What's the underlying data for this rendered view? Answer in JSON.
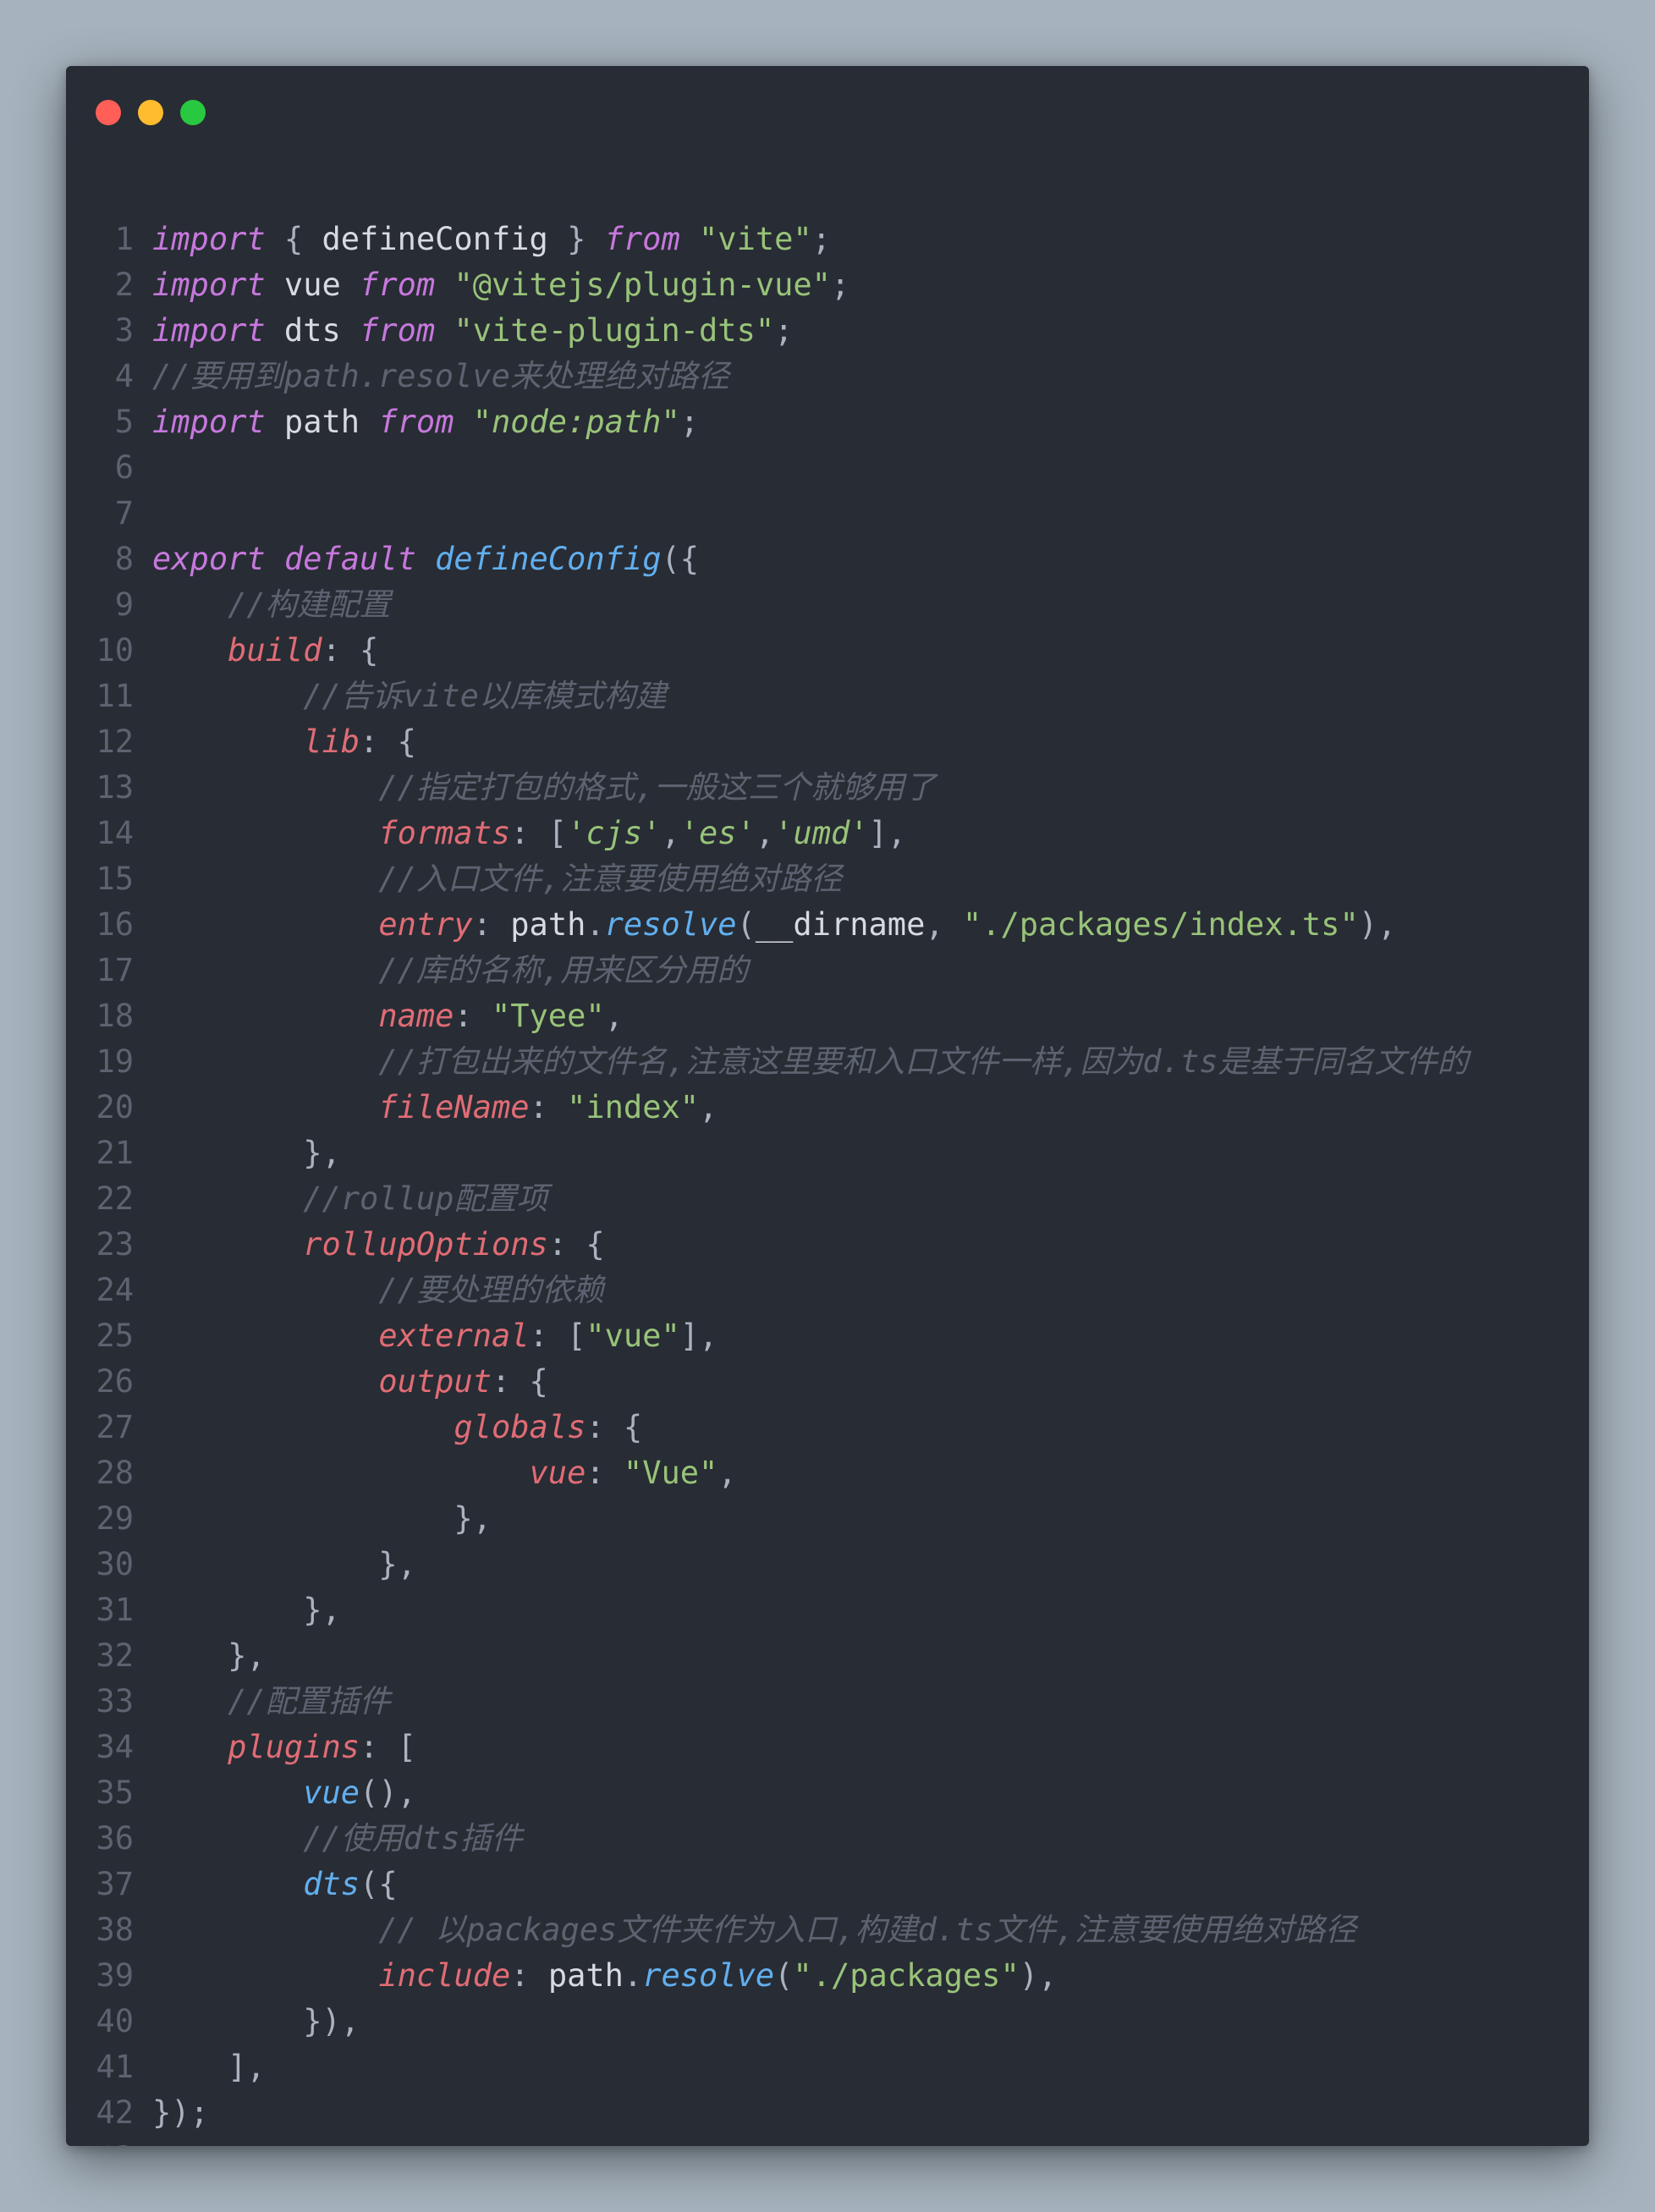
{
  "window": {
    "controls": [
      {
        "name": "close",
        "color": "#ff5f57"
      },
      {
        "name": "minimize",
        "color": "#febc2e"
      },
      {
        "name": "maximize",
        "color": "#28c840"
      }
    ]
  },
  "code": {
    "lines": [
      [
        {
          "t": "import",
          "c": "kw"
        },
        {
          "t": " { ",
          "c": "punc"
        },
        {
          "t": "defineConfig",
          "c": "plain"
        },
        {
          "t": " } ",
          "c": "punc"
        },
        {
          "t": "from",
          "c": "kw"
        },
        {
          "t": " ",
          "c": "punc"
        },
        {
          "t": "\"vite\"",
          "c": "str"
        },
        {
          "t": ";",
          "c": "punc"
        }
      ],
      [
        {
          "t": "import",
          "c": "kw"
        },
        {
          "t": " vue ",
          "c": "plain"
        },
        {
          "t": "from",
          "c": "kw"
        },
        {
          "t": " ",
          "c": "punc"
        },
        {
          "t": "\"@vitejs/plugin-vue\"",
          "c": "str"
        },
        {
          "t": ";",
          "c": "punc"
        }
      ],
      [
        {
          "t": "import",
          "c": "kw"
        },
        {
          "t": " dts ",
          "c": "plain"
        },
        {
          "t": "from",
          "c": "kw"
        },
        {
          "t": " ",
          "c": "punc"
        },
        {
          "t": "\"vite-plugin-dts\"",
          "c": "str"
        },
        {
          "t": ";",
          "c": "punc"
        }
      ],
      [
        {
          "t": "//要用到path.resolve来处理绝对路径",
          "c": "cm"
        }
      ],
      [
        {
          "t": "import",
          "c": "kw"
        },
        {
          "t": " path ",
          "c": "plain"
        },
        {
          "t": "from",
          "c": "kw"
        },
        {
          "t": " ",
          "c": "punc"
        },
        {
          "t": "\"node:path\"",
          "c": "str-i"
        },
        {
          "t": ";",
          "c": "punc"
        }
      ],
      [],
      [],
      [
        {
          "t": "export",
          "c": "kw"
        },
        {
          "t": " ",
          "c": "punc"
        },
        {
          "t": "default",
          "c": "kw"
        },
        {
          "t": " ",
          "c": "punc"
        },
        {
          "t": "defineConfig",
          "c": "fn"
        },
        {
          "t": "({",
          "c": "punc"
        }
      ],
      [
        {
          "t": "    ",
          "c": "punc"
        },
        {
          "t": "//构建配置",
          "c": "cm"
        }
      ],
      [
        {
          "t": "    ",
          "c": "punc"
        },
        {
          "t": "build",
          "c": "prop"
        },
        {
          "t": ": {",
          "c": "punc"
        }
      ],
      [
        {
          "t": "        ",
          "c": "punc"
        },
        {
          "t": "//告诉vite以库模式构建",
          "c": "cm"
        }
      ],
      [
        {
          "t": "        ",
          "c": "punc"
        },
        {
          "t": "lib",
          "c": "prop"
        },
        {
          "t": ": {",
          "c": "punc"
        }
      ],
      [
        {
          "t": "            ",
          "c": "punc"
        },
        {
          "t": "//指定打包的格式,一般这三个就够用了",
          "c": "cm"
        }
      ],
      [
        {
          "t": "            ",
          "c": "punc"
        },
        {
          "t": "formats",
          "c": "prop"
        },
        {
          "t": ": [",
          "c": "punc"
        },
        {
          "t": "'cjs'",
          "c": "str-i"
        },
        {
          "t": ",",
          "c": "punc"
        },
        {
          "t": "'es'",
          "c": "str-i"
        },
        {
          "t": ",",
          "c": "punc"
        },
        {
          "t": "'umd'",
          "c": "str-i"
        },
        {
          "t": "],",
          "c": "punc"
        }
      ],
      [
        {
          "t": "            ",
          "c": "punc"
        },
        {
          "t": "//入口文件,注意要使用绝对路径",
          "c": "cm"
        }
      ],
      [
        {
          "t": "            ",
          "c": "punc"
        },
        {
          "t": "entry",
          "c": "prop"
        },
        {
          "t": ": ",
          "c": "punc"
        },
        {
          "t": "path",
          "c": "plain"
        },
        {
          "t": ".",
          "c": "punc"
        },
        {
          "t": "resolve",
          "c": "fn"
        },
        {
          "t": "(",
          "c": "punc"
        },
        {
          "t": "__dirname",
          "c": "plain"
        },
        {
          "t": ", ",
          "c": "punc"
        },
        {
          "t": "\"./packages/index.ts\"",
          "c": "str"
        },
        {
          "t": "),",
          "c": "punc"
        }
      ],
      [
        {
          "t": "            ",
          "c": "punc"
        },
        {
          "t": "//库的名称,用来区分用的",
          "c": "cm"
        }
      ],
      [
        {
          "t": "            ",
          "c": "punc"
        },
        {
          "t": "name",
          "c": "prop"
        },
        {
          "t": ": ",
          "c": "punc"
        },
        {
          "t": "\"Tyee\"",
          "c": "str"
        },
        {
          "t": ",",
          "c": "punc"
        }
      ],
      [
        {
          "t": "            ",
          "c": "punc"
        },
        {
          "t": "//打包出来的文件名,注意这里要和入口文件一样,因为d.ts是基于同名文件的",
          "c": "cm"
        }
      ],
      [
        {
          "t": "            ",
          "c": "punc"
        },
        {
          "t": "fileName",
          "c": "prop"
        },
        {
          "t": ": ",
          "c": "punc"
        },
        {
          "t": "\"index\"",
          "c": "str"
        },
        {
          "t": ",",
          "c": "punc"
        }
      ],
      [
        {
          "t": "        },",
          "c": "punc"
        }
      ],
      [
        {
          "t": "        ",
          "c": "punc"
        },
        {
          "t": "//rollup配置项",
          "c": "cm"
        }
      ],
      [
        {
          "t": "        ",
          "c": "punc"
        },
        {
          "t": "rollupOptions",
          "c": "prop"
        },
        {
          "t": ": {",
          "c": "punc"
        }
      ],
      [
        {
          "t": "            ",
          "c": "punc"
        },
        {
          "t": "//要处理的依赖",
          "c": "cm"
        }
      ],
      [
        {
          "t": "            ",
          "c": "punc"
        },
        {
          "t": "external",
          "c": "prop"
        },
        {
          "t": ": [",
          "c": "punc"
        },
        {
          "t": "\"vue\"",
          "c": "str"
        },
        {
          "t": "],",
          "c": "punc"
        }
      ],
      [
        {
          "t": "            ",
          "c": "punc"
        },
        {
          "t": "output",
          "c": "prop"
        },
        {
          "t": ": {",
          "c": "punc"
        }
      ],
      [
        {
          "t": "                ",
          "c": "punc"
        },
        {
          "t": "globals",
          "c": "prop"
        },
        {
          "t": ": {",
          "c": "punc"
        }
      ],
      [
        {
          "t": "                    ",
          "c": "punc"
        },
        {
          "t": "vue",
          "c": "prop"
        },
        {
          "t": ": ",
          "c": "punc"
        },
        {
          "t": "\"Vue\"",
          "c": "str"
        },
        {
          "t": ",",
          "c": "punc"
        }
      ],
      [
        {
          "t": "                },",
          "c": "punc"
        }
      ],
      [
        {
          "t": "            },",
          "c": "punc"
        }
      ],
      [
        {
          "t": "        },",
          "c": "punc"
        }
      ],
      [
        {
          "t": "    },",
          "c": "punc"
        }
      ],
      [
        {
          "t": "    ",
          "c": "punc"
        },
        {
          "t": "//配置插件",
          "c": "cm"
        }
      ],
      [
        {
          "t": "    ",
          "c": "punc"
        },
        {
          "t": "plugins",
          "c": "prop"
        },
        {
          "t": ": [",
          "c": "punc"
        }
      ],
      [
        {
          "t": "        ",
          "c": "punc"
        },
        {
          "t": "vue",
          "c": "fn"
        },
        {
          "t": "(),",
          "c": "punc"
        }
      ],
      [
        {
          "t": "        ",
          "c": "punc"
        },
        {
          "t": "//使用dts插件",
          "c": "cm"
        }
      ],
      [
        {
          "t": "        ",
          "c": "punc"
        },
        {
          "t": "dts",
          "c": "fn"
        },
        {
          "t": "({",
          "c": "punc"
        }
      ],
      [
        {
          "t": "            ",
          "c": "punc"
        },
        {
          "t": "// 以packages文件夹作为入口,构建d.ts文件,注意要使用绝对路径",
          "c": "cm"
        }
      ],
      [
        {
          "t": "            ",
          "c": "punc"
        },
        {
          "t": "include",
          "c": "prop"
        },
        {
          "t": ": ",
          "c": "punc"
        },
        {
          "t": "path",
          "c": "plain"
        },
        {
          "t": ".",
          "c": "punc"
        },
        {
          "t": "resolve",
          "c": "fn"
        },
        {
          "t": "(",
          "c": "punc"
        },
        {
          "t": "\"./packages\"",
          "c": "str"
        },
        {
          "t": "),",
          "c": "punc"
        }
      ],
      [
        {
          "t": "        }),",
          "c": "punc"
        }
      ],
      [
        {
          "t": "    ],",
          "c": "punc"
        }
      ],
      [
        {
          "t": "});",
          "c": "punc"
        }
      ],
      []
    ]
  }
}
